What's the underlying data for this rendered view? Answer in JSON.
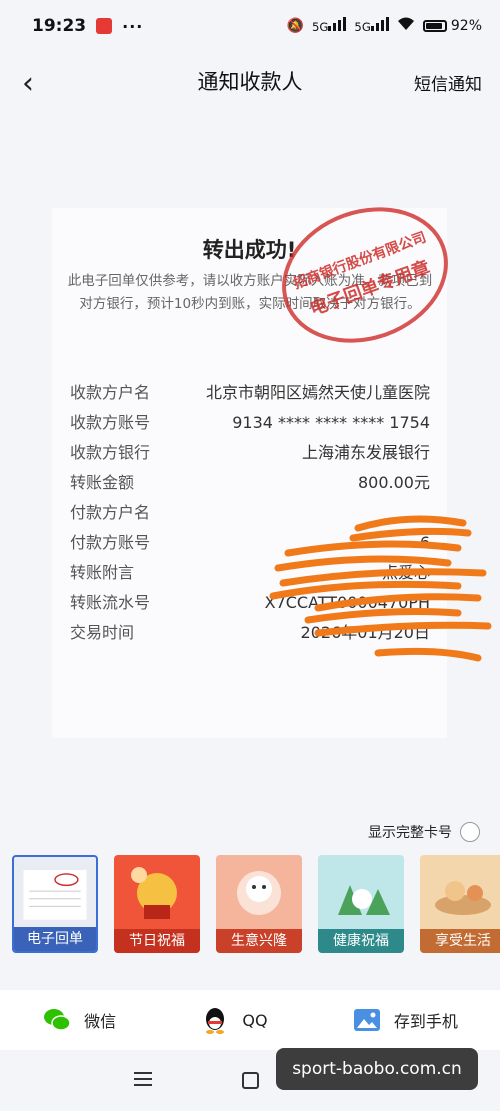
{
  "status_bar": {
    "time": "19:23",
    "dots": "···",
    "signal1": "5G",
    "signal2": "5G",
    "battery": "92%"
  },
  "nav": {
    "back": "‹",
    "title": "通知收款人",
    "action": "短信通知"
  },
  "receipt": {
    "title": "转出成功!",
    "notice": "此电子回单仅供参考，请以收方账户实际入账为准。款项已到对方银行，预计10秒内到账，实际时间取决于对方银行。",
    "stamp_line1": "招商银行股份有限公司",
    "stamp_line2": "电子回单专用章",
    "fields": [
      {
        "label": "收款方户名",
        "value": "北京市朝阳区嫣然天使儿童医院"
      },
      {
        "label": "收款方账号",
        "value": "9134 **** **** **** 1754"
      },
      {
        "label": "收款方银行",
        "value": "上海浦东发展银行"
      },
      {
        "label": "转账金额",
        "value": "800.00元"
      },
      {
        "label": "付款方户名",
        "value": ""
      },
      {
        "label": "付款方账号",
        "value": "6"
      },
      {
        "label": "转账附言",
        "value": "点爱心"
      },
      {
        "label": "转账流水号",
        "value": "X7CCATT0000470PH"
      },
      {
        "label": "交易时间",
        "value": "2026年01月20日"
      }
    ]
  },
  "options": {
    "show_full_card": "显示完整卡号"
  },
  "templates": [
    {
      "label": "电子回单",
      "selected": true
    },
    {
      "label": "节日祝福"
    },
    {
      "label": "生意兴隆"
    },
    {
      "label": "健康祝福"
    },
    {
      "label": "享受生活"
    }
  ],
  "share": {
    "wechat": "微信",
    "qq": "QQ",
    "save": "存到手机"
  },
  "watermark": "sport-baobo.com.cn",
  "colors": {
    "stamp_red": "#ce2c28",
    "scribble_orange": "#f07a1a",
    "selected_blue": "#3a62b8"
  }
}
